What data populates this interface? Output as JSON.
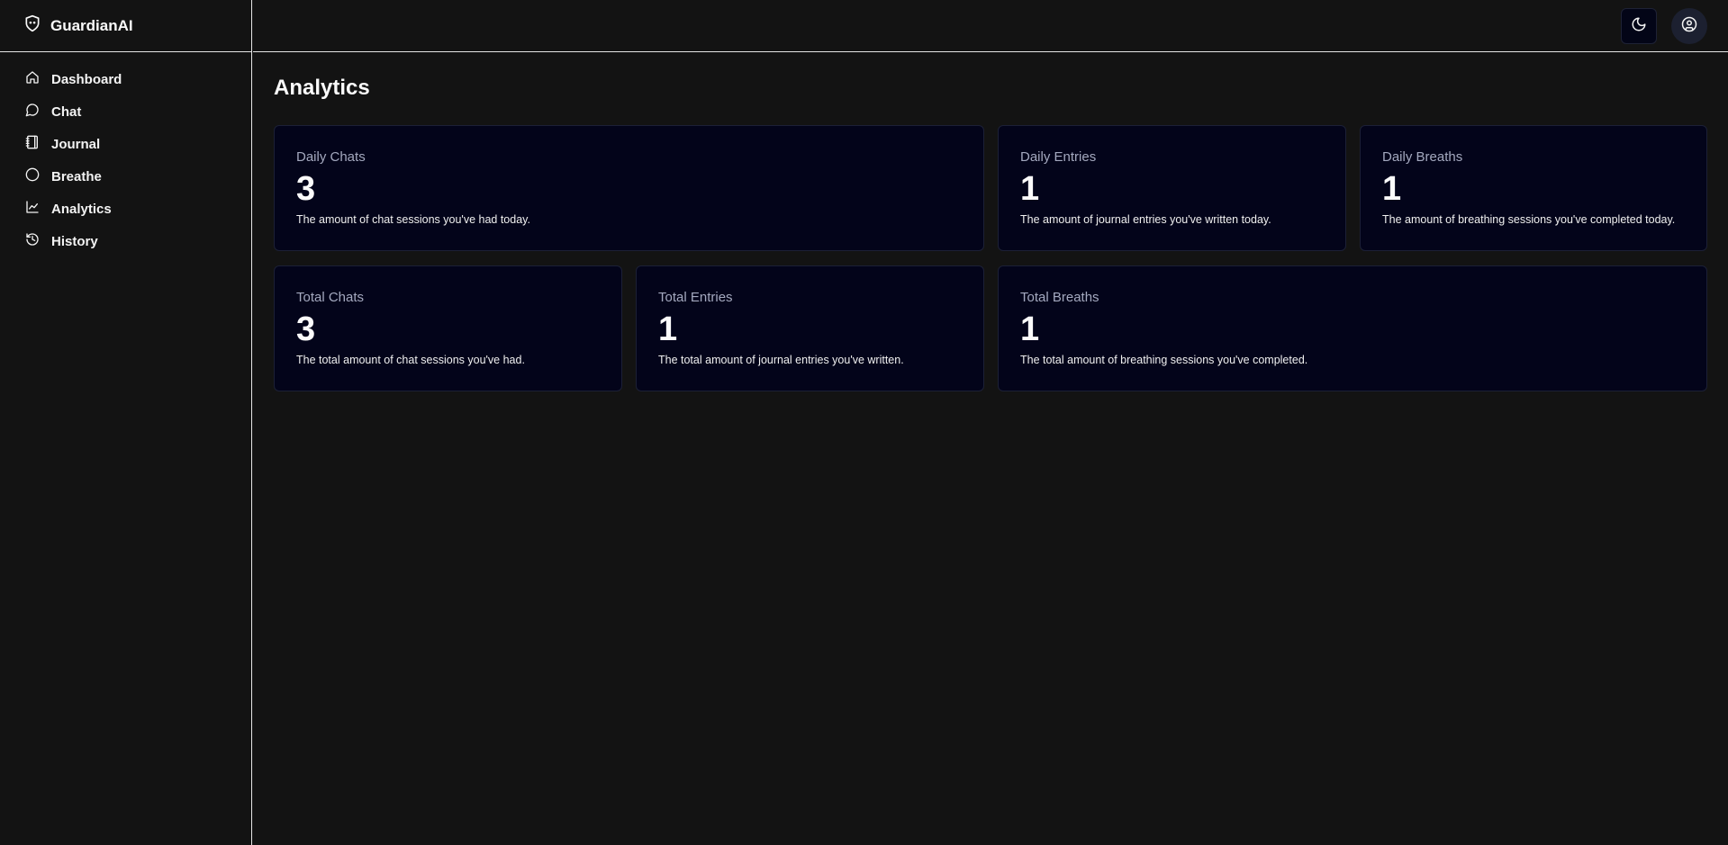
{
  "app": {
    "name": "GuardianAI"
  },
  "sidebar": {
    "items": [
      {
        "label": "Dashboard",
        "icon": "home-icon"
      },
      {
        "label": "Chat",
        "icon": "message-circle-icon"
      },
      {
        "label": "Journal",
        "icon": "notebook-icon"
      },
      {
        "label": "Breathe",
        "icon": "circle-icon"
      },
      {
        "label": "Analytics",
        "icon": "line-chart-icon"
      },
      {
        "label": "History",
        "icon": "history-icon"
      }
    ]
  },
  "header": {
    "theme_toggle_icon": "moon-icon",
    "account_icon": "user-circle-icon"
  },
  "page": {
    "title": "Analytics"
  },
  "cards": [
    {
      "title": "Daily Chats",
      "value": "3",
      "description": "The amount of chat sessions you've had today."
    },
    {
      "title": "Daily Entries",
      "value": "1",
      "description": "The amount of journal entries you've written today."
    },
    {
      "title": "Daily Breaths",
      "value": "1",
      "description": "The amount of breathing sessions you've completed today."
    },
    {
      "title": "Total Chats",
      "value": "3",
      "description": "The total amount of chat sessions you've had."
    },
    {
      "title": "Total Entries",
      "value": "1",
      "description": "The total amount of journal entries you've written."
    },
    {
      "title": "Total Breaths",
      "value": "1",
      "description": "The total amount of breathing sessions you've completed."
    }
  ],
  "colors": {
    "background": "#131313",
    "card_background": "#03041a",
    "card_border": "#1c2036",
    "divider": "#e6e6e6",
    "muted_text": "#a4a9bf"
  }
}
